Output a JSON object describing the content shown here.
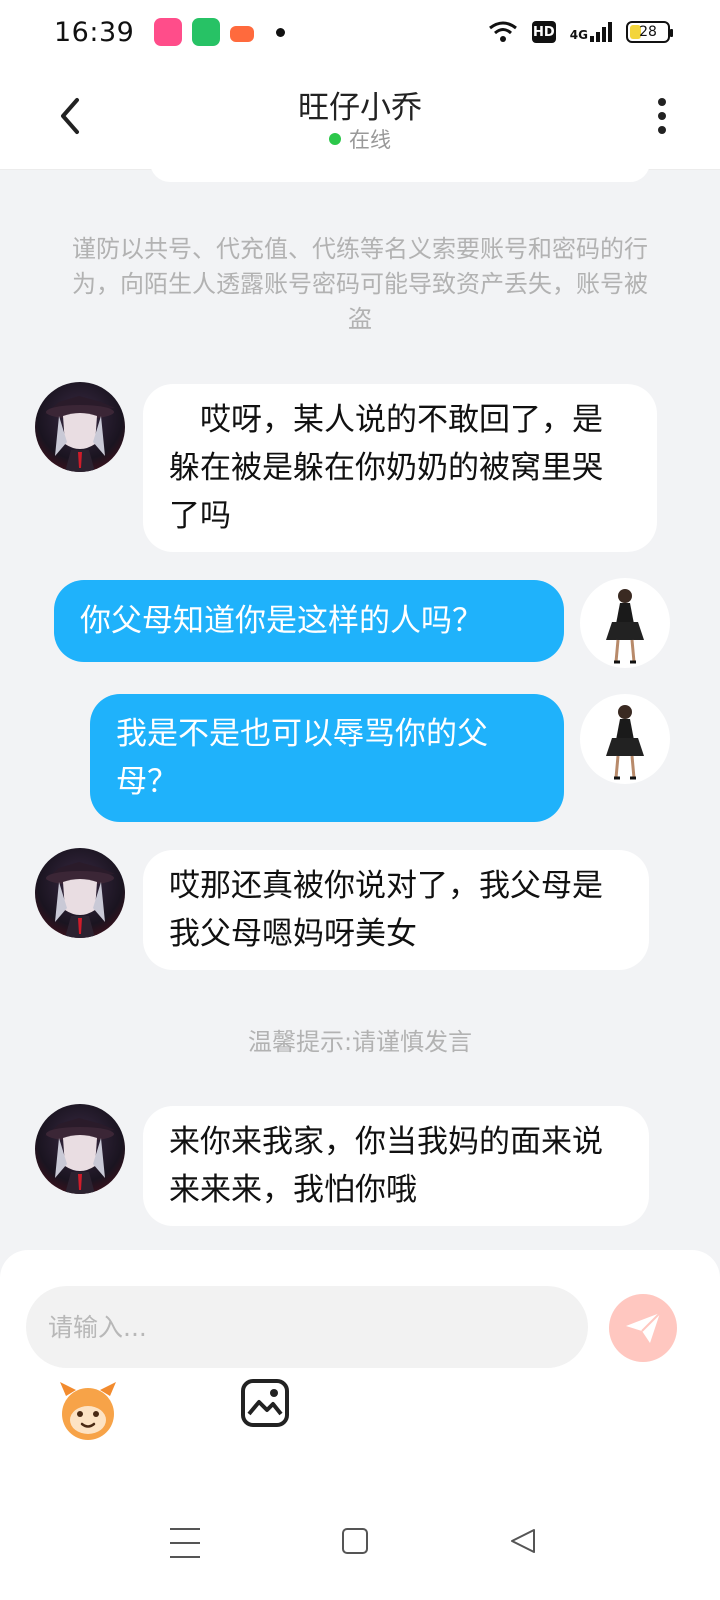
{
  "status_bar": {
    "time": "16:39",
    "network": "4G",
    "hd": "HD",
    "battery": "28"
  },
  "header": {
    "title": "旺仔小乔",
    "status": "在线"
  },
  "warning": "谨防以共号、代充值、代练等名义索要账号和密码的行为，向陌生人透露账号密码可能导致资产丢失，账号被盗",
  "messages": [
    {
      "side": "left",
      "text": "　哎呀，某人说的不敢回了，是躲在被是躲在你奶奶的被窝里哭了吗"
    },
    {
      "side": "right",
      "text": "你父母知道你是这样的人吗？"
    },
    {
      "side": "right",
      "text": "我是不是也可以辱骂你的父母？"
    },
    {
      "side": "left",
      "text": "哎那还真被你说对了，我父母是我父母嗯妈呀美女"
    },
    {
      "side": "left",
      "text": "来你来我家，你当我妈的面来说来来来，我怕你哦"
    }
  ],
  "tip": "温馨提示:请谨慎发言",
  "input": {
    "placeholder": "请输入..."
  },
  "colors": {
    "accent": "#1fb2fb",
    "online": "#2cc74a",
    "send": "#ffc7c0"
  },
  "icons": [
    "back-icon",
    "more-icon",
    "send-icon",
    "emoji-icon",
    "image-icon"
  ]
}
